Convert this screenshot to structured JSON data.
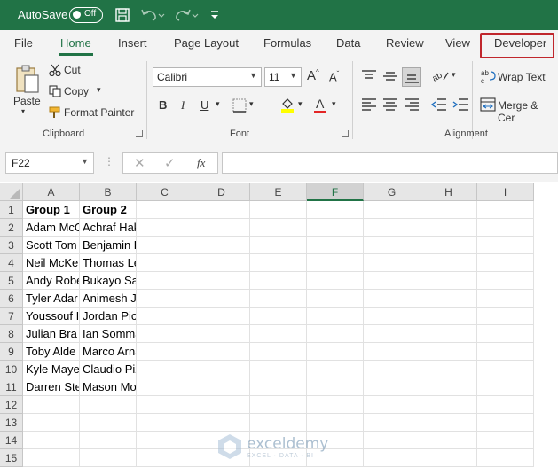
{
  "titlebar": {
    "autosave_label": "AutoSave",
    "toggle_state": "Off"
  },
  "tabs": [
    "File",
    "Home",
    "Insert",
    "Page Layout",
    "Formulas",
    "Data",
    "Review",
    "View",
    "Developer"
  ],
  "active_tab": "Home",
  "highlighted_tab": "Developer",
  "ribbon": {
    "clipboard": {
      "paste": "Paste",
      "cut": "Cut",
      "copy": "Copy",
      "format_painter": "Format Painter",
      "label": "Clipboard"
    },
    "font": {
      "name": "Calibri",
      "size": "11",
      "label": "Font",
      "bold": "B",
      "italic": "I",
      "underline": "U"
    },
    "alignment": {
      "wrap_text": "Wrap Text",
      "merge_center": "Merge & Cer",
      "label": "Alignment"
    }
  },
  "formula_bar": {
    "name_box": "F22",
    "fx": "fx",
    "content": ""
  },
  "columns": [
    "A",
    "B",
    "C",
    "D",
    "E",
    "F",
    "G",
    "H",
    "I"
  ],
  "selected_column": "F",
  "rows": [
    "1",
    "2",
    "3",
    "4",
    "5",
    "6",
    "7",
    "8",
    "9",
    "10",
    "11",
    "12",
    "13",
    "14",
    "15"
  ],
  "cells": {
    "A": [
      "Group 1",
      "Adam McC",
      "Scott Tom",
      "Neil McKe",
      "Andy Robe",
      "Tyler Adar",
      "Youssouf I",
      "Julian Bra",
      "Toby Alde",
      "Kyle Maye",
      "Darren Ste"
    ],
    "B": [
      "Group 2",
      "Achraf Hakimi",
      "Benjamin Pavard",
      "Thomas Lemar",
      "Bukayo Saka",
      "Animesh Jain",
      "Jordan Pickford",
      "Ian Sommar",
      "Marco Arnautovic",
      "Claudio Pizzaro",
      "Mason Mount"
    ]
  },
  "watermark": {
    "title": "exceldemy",
    "subtitle": "EXCEL · DATA · BI"
  },
  "colors": {
    "accent": "#217346",
    "highlight_box": "#c0262c"
  }
}
